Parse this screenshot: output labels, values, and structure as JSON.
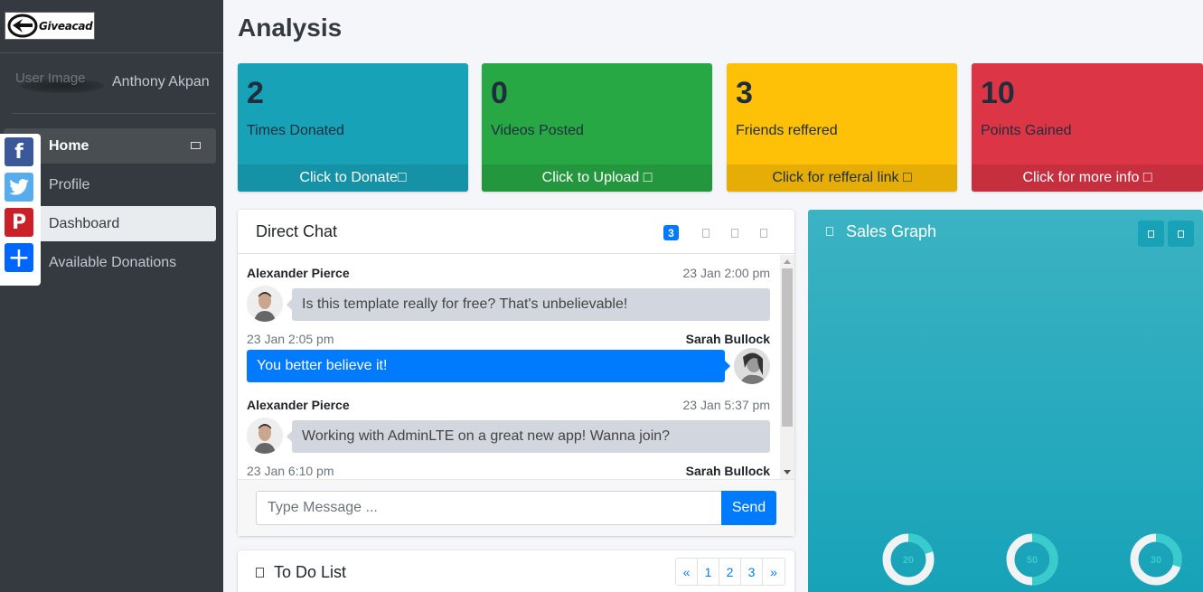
{
  "brand": {
    "logo_text": "Giveacad"
  },
  "user": {
    "image_alt": "User Image",
    "name": "Anthony Akpan"
  },
  "sidebar": {
    "items": [
      {
        "label": "Home"
      },
      {
        "label": "Profile"
      },
      {
        "label": "Dashboard"
      },
      {
        "label": "Available Donations"
      }
    ]
  },
  "social": [
    {
      "name": "facebook",
      "glyph": "f"
    },
    {
      "name": "twitter",
      "glyph": ""
    },
    {
      "name": "pinterest",
      "glyph": "P"
    },
    {
      "name": "share",
      "glyph": "+"
    }
  ],
  "page": {
    "title": "Analysis"
  },
  "stats": [
    {
      "value": "2",
      "label": "Times Donated",
      "footer": "Click to Donate□",
      "color": "#17a2b8"
    },
    {
      "value": "0",
      "label": "Videos Posted",
      "footer": "Click to Upload □",
      "color": "#28a745"
    },
    {
      "value": "3",
      "label": "Friends reffered",
      "footer": "Click for refferal link □",
      "color": "#ffc107"
    },
    {
      "value": "10",
      "label": "Points Gained",
      "footer": "Click for more info □",
      "color": "#dc3545"
    }
  ],
  "chat": {
    "title": "Direct Chat",
    "badge": "3",
    "messages": [
      {
        "name": "Alexander Pierce",
        "time": "23 Jan 2:00 pm",
        "text": "Is this template really for free? That's unbelievable!",
        "side": "left"
      },
      {
        "name": "Sarah Bullock",
        "time": "23 Jan 2:05 pm",
        "text": "You better believe it!",
        "side": "right"
      },
      {
        "name": "Alexander Pierce",
        "time": "23 Jan 5:37 pm",
        "text": "Working with AdminLTE on a great new app! Wanna join?",
        "side": "left"
      },
      {
        "name": "Sarah Bullock",
        "time": "23 Jan 6:10 pm",
        "text": "",
        "side": "right"
      }
    ],
    "input_placeholder": "Type Message ...",
    "send_label": "Send"
  },
  "todo": {
    "title": "To Do List",
    "pages": [
      "«",
      "1",
      "2",
      "3",
      "»"
    ]
  },
  "sales": {
    "title": "Sales Graph",
    "knobs": [
      {
        "value": 20
      },
      {
        "value": 50
      },
      {
        "value": 30
      }
    ]
  }
}
